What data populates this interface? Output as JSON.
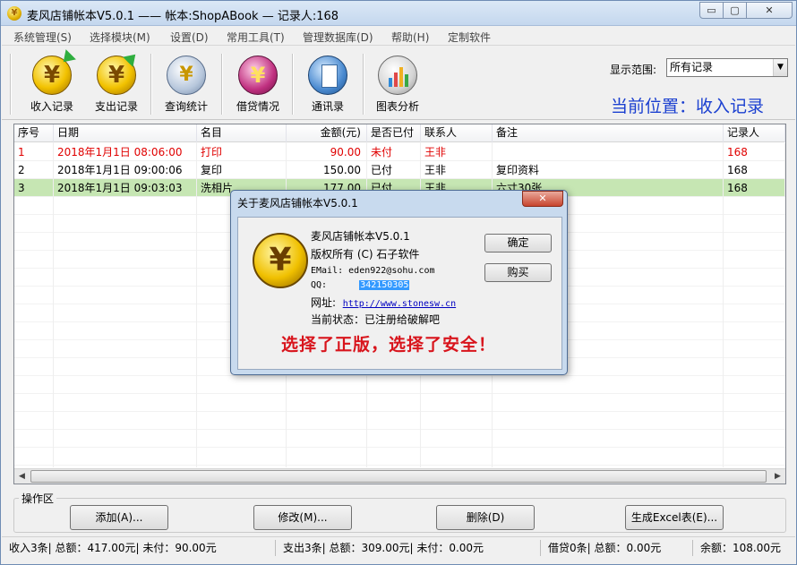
{
  "window": {
    "app_icon_glyph": "¥",
    "title": "麦风店铺帐本V5.0.1  ——  帐本:ShopABook — 记录人:168",
    "min_glyph": "▭",
    "max_glyph": "▢",
    "close_glyph": "✕"
  },
  "menu": {
    "items": [
      {
        "label": "系统管理(S)"
      },
      {
        "label": "选择模块(M)"
      },
      {
        "label": "设置(D)"
      },
      {
        "label": "常用工具(T)"
      },
      {
        "label": "管理数据库(D)"
      },
      {
        "label": "帮助(H)"
      },
      {
        "label": "定制软件"
      }
    ]
  },
  "toolbar": {
    "tools": [
      {
        "label": "收入记录",
        "icon": "income-icon",
        "glyph": "¥"
      },
      {
        "label": "支出记录",
        "icon": "expense-icon",
        "glyph": "¥"
      },
      {
        "label": "查询统计",
        "icon": "search-stats-icon",
        "glyph": "¥"
      },
      {
        "label": "借贷情况",
        "icon": "loan-icon",
        "glyph": "¥"
      },
      {
        "label": "通讯录",
        "icon": "contacts-book-icon",
        "glyph": ""
      },
      {
        "label": "图表分析",
        "icon": "bar-chart-icon",
        "glyph": ""
      }
    ],
    "range_label": "显示范围:",
    "range_value": "所有记录",
    "dropdown_glyph": "▼",
    "current_position": "当前位置：收入记录"
  },
  "grid": {
    "columns": [
      "序号",
      "日期",
      "名目",
      "金额(元)",
      "是否已付",
      "联系人",
      "备注",
      "记录人"
    ],
    "rows": [
      {
        "no": "1",
        "date": "2018年1月1日 08:06:00",
        "item": "打印",
        "amount": "90.00",
        "paid": "未付",
        "contact": "王非",
        "note": "",
        "recorder": "168"
      },
      {
        "no": "2",
        "date": "2018年1月1日 09:00:06",
        "item": "复印",
        "amount": "150.00",
        "paid": "已付",
        "contact": "王非",
        "note": "复印资料",
        "recorder": "168"
      },
      {
        "no": "3",
        "date": "2018年1月1日 09:03:03",
        "item": "洗相片",
        "amount": "177.00",
        "paid": "已付",
        "contact": "王非",
        "note": "六寸30张",
        "recorder": "168"
      }
    ],
    "row_colors": {
      "selected_bg": "#ffffff",
      "selected_text": "#e00000",
      "green_bg": "#c6e6b3"
    },
    "scroll_left_glyph": "◀",
    "scroll_right_glyph": "▶"
  },
  "actions": {
    "group_title": "操作区",
    "add": "添加(A)...",
    "edit": "修改(M)...",
    "delete": "删除(D)",
    "excel": "生成Excel表(E)..."
  },
  "status": {
    "income": "收入3条| 总额：417.00元| 未付：90.00元",
    "expense": "支出3条| 总额：309.00元| 未付：0.00元",
    "loan": "借贷0条| 总额：0.00元",
    "balance": "余额：108.00元"
  },
  "about": {
    "title": "关于麦风店铺帐本V5.0.1",
    "close_glyph": "✕",
    "coin_glyph": "¥",
    "product": "麦风店铺帐本V5.0.1",
    "copyright": "版权所有 (C) 石子软件",
    "email_label": "EMail:",
    "email": "eden922@sohu.com",
    "qq_label": "QQ:",
    "qq": "342150305",
    "url_label": "网址:",
    "url": "http://www.stonesw.cn",
    "status": "当前状态：已注册给破解吧",
    "slogan": "选择了正版，选择了安全！",
    "ok": "确定",
    "buy": "购买"
  }
}
